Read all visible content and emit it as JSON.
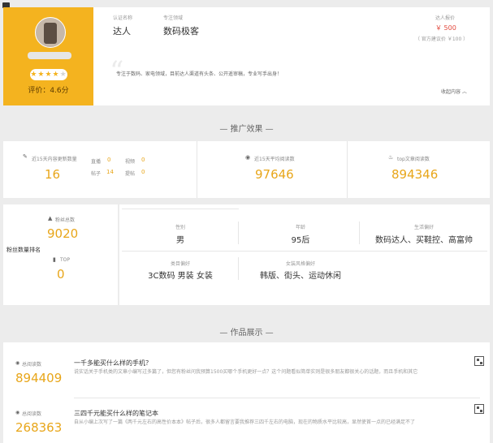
{
  "profile": {
    "stars_filled": "★★★★",
    "stars_empty": "★",
    "rating": 4,
    "score_label": "评价：4.6分"
  },
  "info": {
    "cert_label": "认证名称",
    "cert_value": "达人",
    "field_label": "专注领域",
    "field_value": "数码极客",
    "price_label": "达人报价",
    "price_value": "￥ 500",
    "official_price": "（ 官方建议价 ￥100 ）",
    "description": "专注于数码、家电领域，目前达人渠道有头条、公开遥审稿，专业写手出身！",
    "collapse": "收起内容 ︿"
  },
  "promo_section": {
    "title": "— 推广效果 —"
  },
  "stats": {
    "recent_label": "近15天内容更新数量",
    "recent_value": "16",
    "live_label": "直播",
    "live_value": "0",
    "video_label": "视频",
    "video_value": "0",
    "post_label": "帖子",
    "post_value": "14",
    "ask_label": "提帖",
    "ask_value": "0",
    "avg_read_label": "近15天平均阅读数",
    "avg_read_value": "97646",
    "top_read_label": "top文章阅读数",
    "top_read_value": "894346"
  },
  "fans": {
    "count_label": "粉丝总数",
    "count_value": "9020",
    "rank_label": "粉丝数量排名",
    "top_label": "TOP",
    "top_value": "0"
  },
  "attrs": [
    {
      "label": "性别",
      "value": "男"
    },
    {
      "label": "年龄",
      "value": "95后"
    },
    {
      "label": "生活偏好",
      "value": "数码达人、买鞋控、高富帅"
    },
    {
      "label": "类目偏好",
      "value": "3C数码 男装 女装"
    },
    {
      "label": "女装风格偏好",
      "value": "韩版、街头、运动休闲"
    }
  ],
  "works_section": {
    "title": "— 作品展示 —"
  },
  "works": [
    {
      "read_label": "总阅读数",
      "read_value": "894409",
      "title": "一千多能买什么样的手机？",
      "desc": "说实话关于手机类的文章小编写过多篇了，但您有粉丝问我预算1500买哪个手机更好一点？这个问题看似简单实则是很多朋友都很关心的话题，而且手机和其它"
    },
    {
      "read_label": "总阅读数",
      "read_value": "268363",
      "title": "三四千元能买什么样的笔记本",
      "desc": "自从小编上次写了一篇《两千元左右的高性价本本》帖子后，很多人都留言要我推荐三四千左右的电脑，现在的物质水平比较高，显然使首一点的已经满足不了"
    }
  ],
  "colors": {
    "brand": "#f4b31f",
    "accent": "#e8a61a",
    "price": "#e2473b"
  }
}
